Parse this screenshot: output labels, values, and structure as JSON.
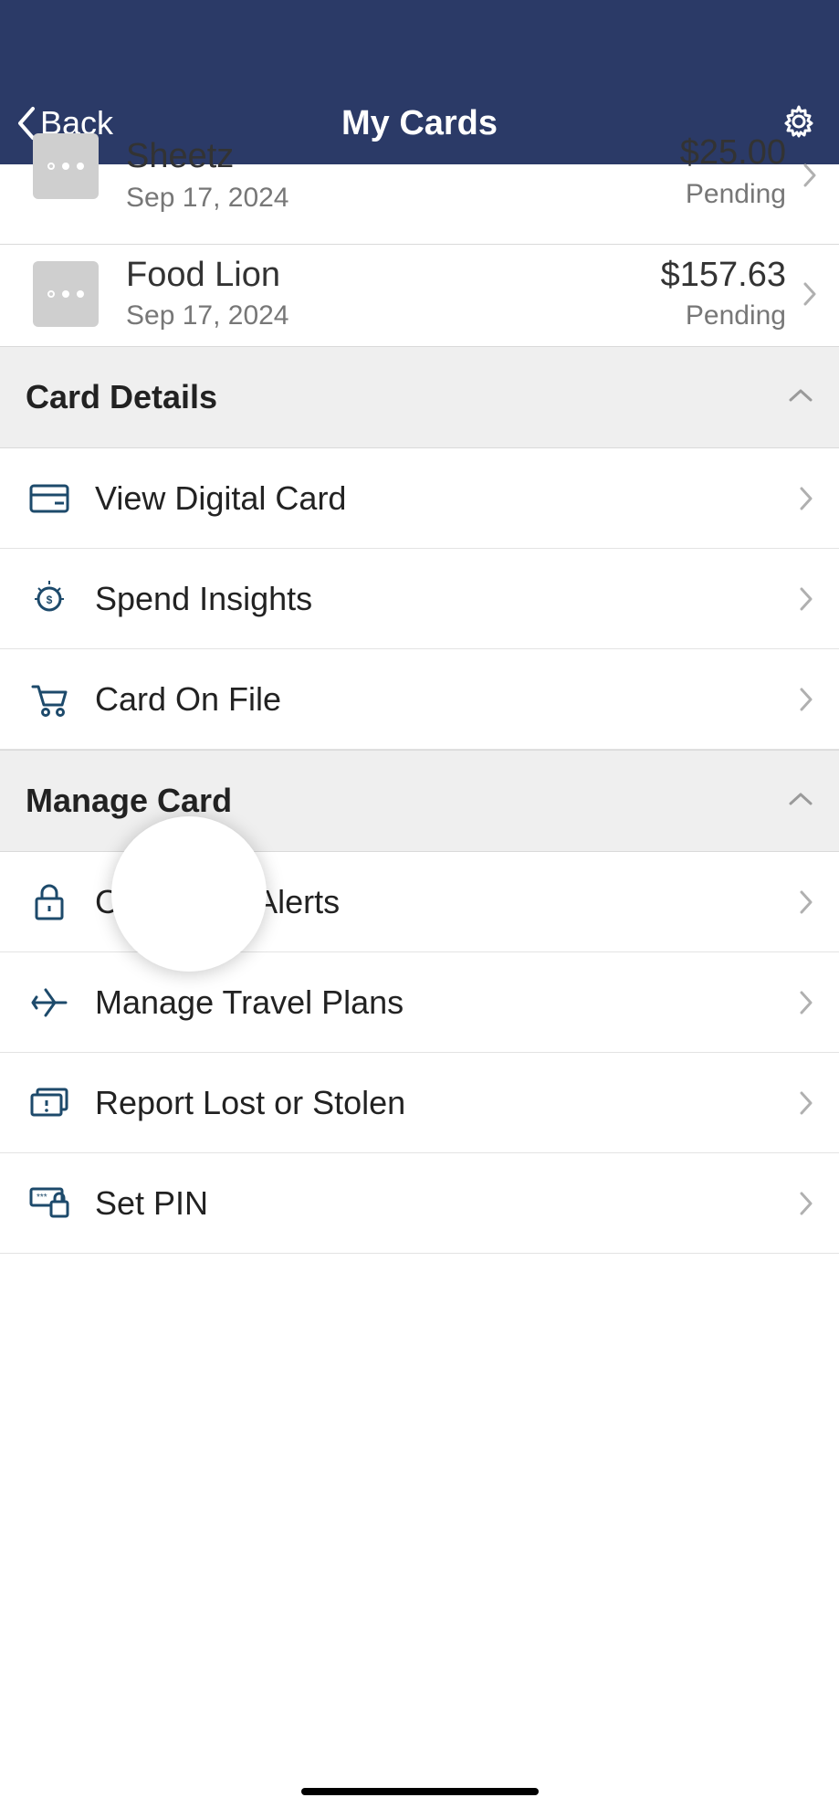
{
  "header": {
    "back_label": "Back",
    "title": "My Cards"
  },
  "transactions": [
    {
      "merchant": "Sheetz",
      "date": "Sep 17, 2024",
      "amount": "$25.00",
      "status": "Pending"
    },
    {
      "merchant": "Food Lion",
      "date": "Sep 17, 2024",
      "amount": "$157.63",
      "status": "Pending"
    }
  ],
  "sections": {
    "card_details": {
      "title": "Card Details",
      "items": [
        {
          "label": "View Digital Card"
        },
        {
          "label": "Spend Insights"
        },
        {
          "label": "Card On File"
        }
      ]
    },
    "manage_card": {
      "title": "Manage Card",
      "items": [
        {
          "label": "Controls & Alerts"
        },
        {
          "label": "Manage Travel Plans"
        },
        {
          "label": "Report Lost or Stolen"
        },
        {
          "label": "Set PIN"
        }
      ]
    }
  }
}
